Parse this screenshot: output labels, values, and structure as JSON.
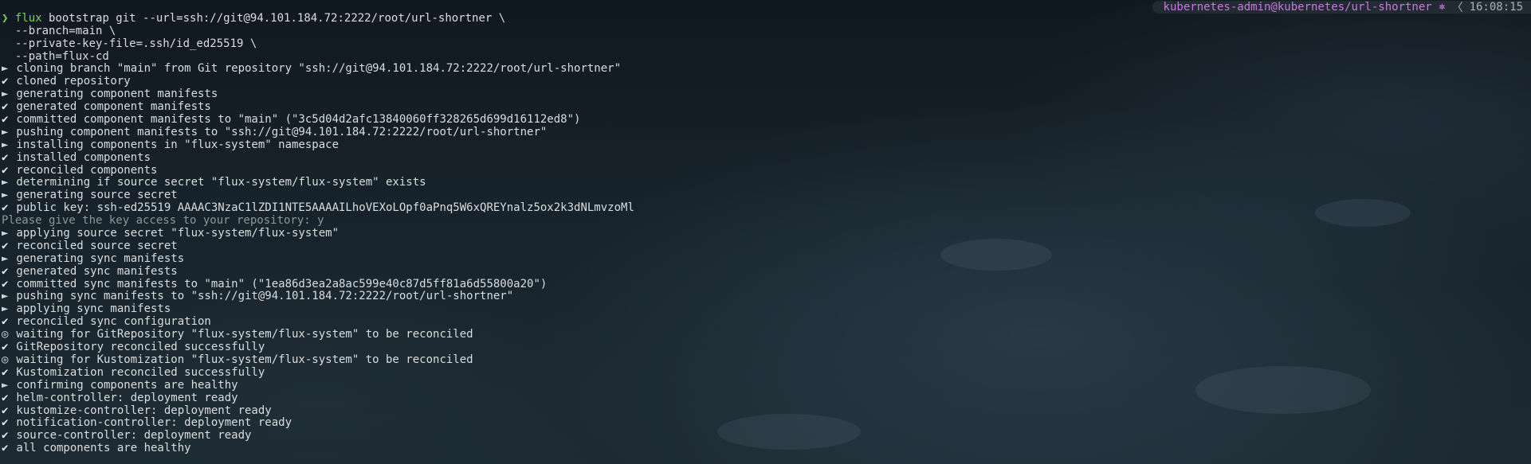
{
  "prompt": {
    "cwd": "~",
    "arrow": "❯",
    "command": "flux",
    "args": " bootstrap git --url=ssh://git@94.101.184.72:2222/root/url-shortner \\",
    "continuations": [
      "  --branch=main \\",
      "  --private-key-file=.ssh/id_ed25519 \\",
      "  --path=flux-cd"
    ]
  },
  "status_bar": {
    "context": "kubernetes-admin@kubernetes/url-shortner ⎈",
    "separator": "〈",
    "time": "16:08:15"
  },
  "output": [
    {
      "sym": "►",
      "text": " cloning branch \"main\" from Git repository \"ssh://git@94.101.184.72:2222/root/url-shortner\""
    },
    {
      "sym": "✔",
      "text": " cloned repository"
    },
    {
      "sym": "►",
      "text": " generating component manifests"
    },
    {
      "sym": "✔",
      "text": " generated component manifests"
    },
    {
      "sym": "✔",
      "text": " committed component manifests to \"main\" (\"3c5d04d2afc13840060ff328265d699d16112ed8\")"
    },
    {
      "sym": "►",
      "text": " pushing component manifests to \"ssh://git@94.101.184.72:2222/root/url-shortner\""
    },
    {
      "sym": "►",
      "text": " installing components in \"flux-system\" namespace"
    },
    {
      "sym": "✔",
      "text": " installed components"
    },
    {
      "sym": "✔",
      "text": " reconciled components"
    },
    {
      "sym": "►",
      "text": " determining if source secret \"flux-system/flux-system\" exists"
    },
    {
      "sym": "►",
      "text": " generating source secret"
    },
    {
      "sym": "✔",
      "text": " public key: ssh-ed25519 AAAAC3NzaC1lZDI1NTE5AAAAILhoVEXoLOpf0aPnq5W6xQREYnalz5ox2k3dNLmvzoMl"
    },
    {
      "sym": "",
      "text": "Please give the key access to your repository: y",
      "dim": true
    },
    {
      "sym": "►",
      "text": " applying source secret \"flux-system/flux-system\""
    },
    {
      "sym": "✔",
      "text": " reconciled source secret"
    },
    {
      "sym": "►",
      "text": " generating sync manifests"
    },
    {
      "sym": "✔",
      "text": " generated sync manifests"
    },
    {
      "sym": "✔",
      "text": " committed sync manifests to \"main\" (\"1ea86d3ea2a8ac599e40c87d5ff81a6d55800a20\")"
    },
    {
      "sym": "►",
      "text": " pushing sync manifests to \"ssh://git@94.101.184.72:2222/root/url-shortner\""
    },
    {
      "sym": "►",
      "text": " applying sync manifests"
    },
    {
      "sym": "✔",
      "text": " reconciled sync configuration"
    },
    {
      "sym": "◎",
      "text": " waiting for GitRepository \"flux-system/flux-system\" to be reconciled"
    },
    {
      "sym": "✔",
      "text": " GitRepository reconciled successfully"
    },
    {
      "sym": "◎",
      "text": " waiting for Kustomization \"flux-system/flux-system\" to be reconciled"
    },
    {
      "sym": "✔",
      "text": " Kustomization reconciled successfully"
    },
    {
      "sym": "►",
      "text": " confirming components are healthy"
    },
    {
      "sym": "✔",
      "text": " helm-controller: deployment ready"
    },
    {
      "sym": "✔",
      "text": " kustomize-controller: deployment ready"
    },
    {
      "sym": "✔",
      "text": " notification-controller: deployment ready"
    },
    {
      "sym": "✔",
      "text": " source-controller: deployment ready"
    },
    {
      "sym": "✔",
      "text": " all components are healthy"
    }
  ],
  "colors": {
    "prompt_green": "#7fd15c",
    "context_purple": "#c678dd",
    "tilde_blue": "#6fa8dc"
  }
}
